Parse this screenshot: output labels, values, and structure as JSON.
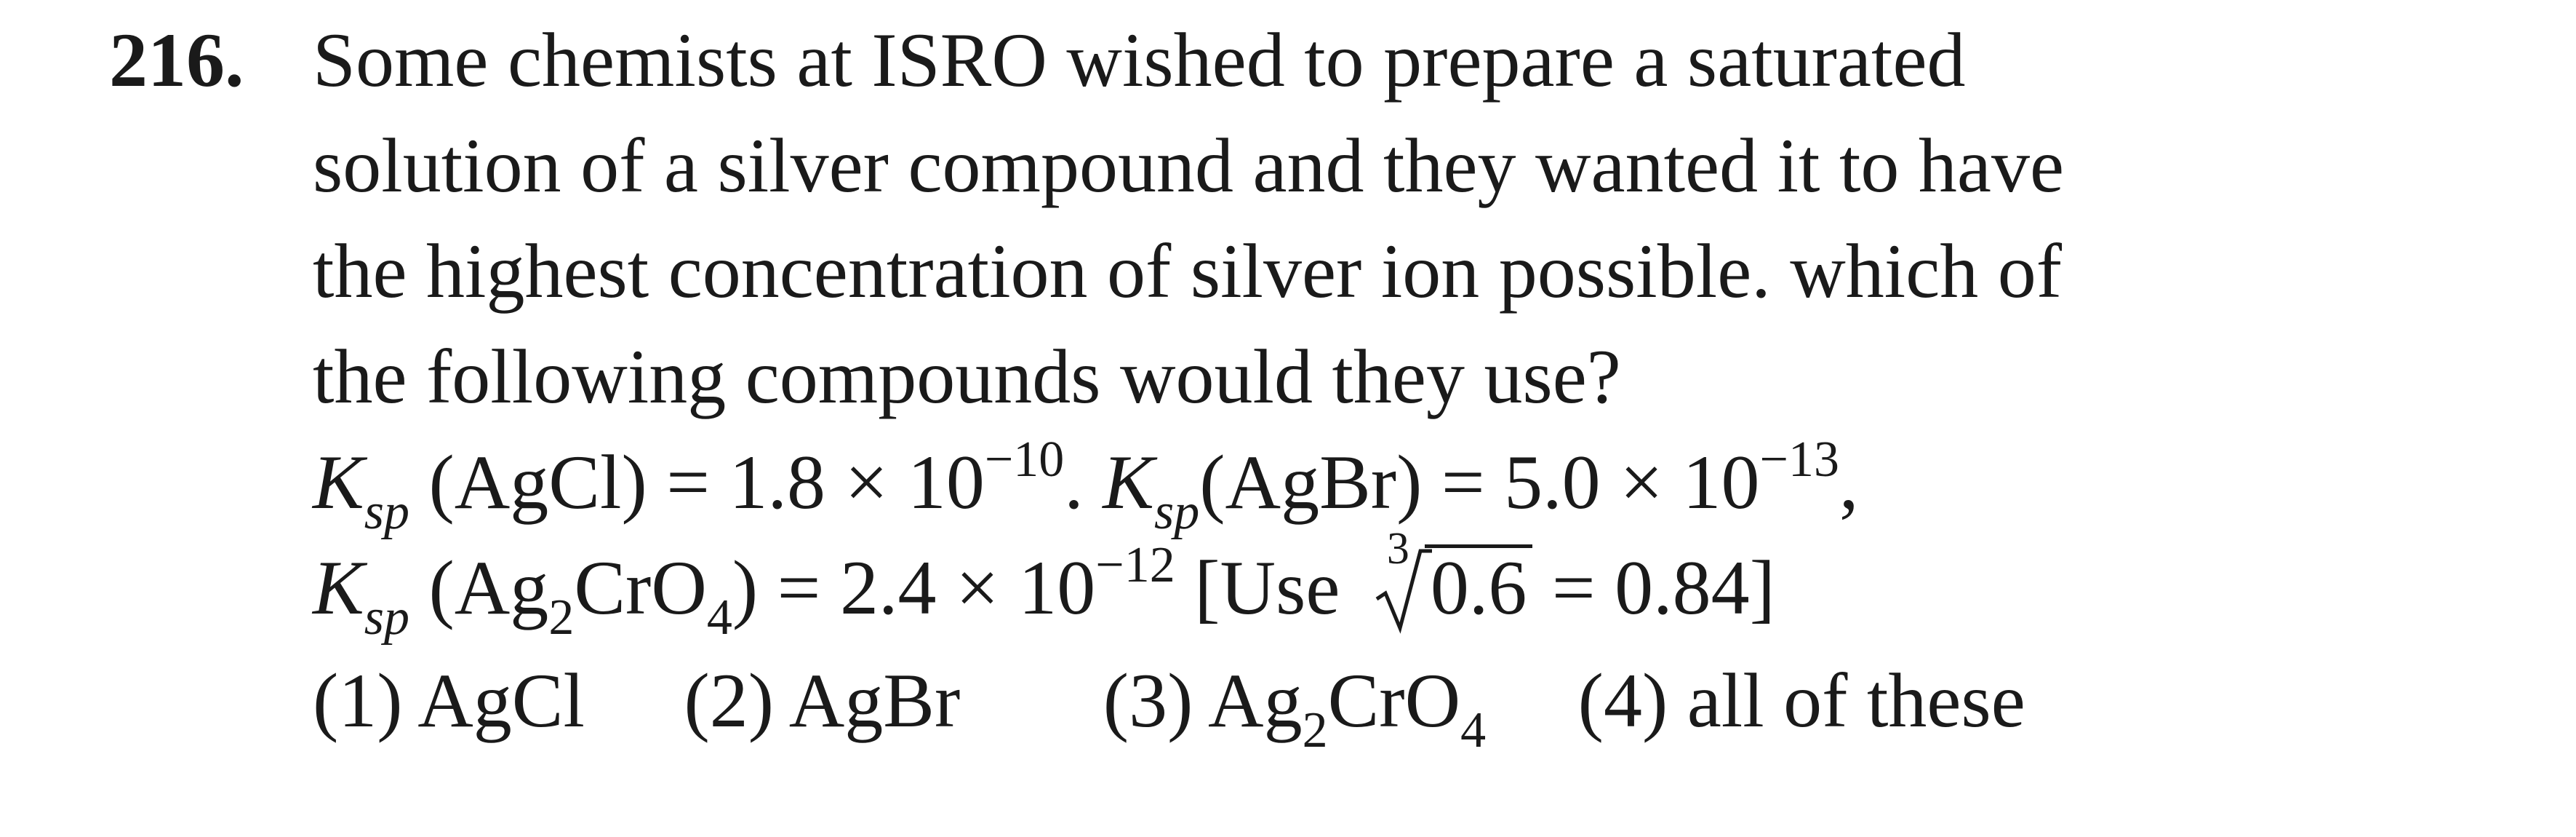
{
  "question": {
    "number": "216.",
    "lines": [
      "Some chemists at ISRO wished to prepare a saturated",
      "solution of a silver compound and they wanted it to have",
      "the highest concentration of silver ion possible. which of",
      "the following compounds would they use?"
    ]
  },
  "data_lines": {
    "ksp_symbol": "K",
    "ksp_sub": "sp",
    "agcl_label": "(AgCl) = 1.8 × 10",
    "agcl_exp": "−10",
    "sep": ". ",
    "agbr_label": "(AgBr) = 5.0 × 10",
    "agbr_exp": "−13",
    "comma": ",",
    "ag2cro4_open": "(Ag",
    "ag2cro4_sub2": "2",
    "ag2cro4_mid": "CrO",
    "ag2cro4_sub4": "4",
    "ag2cro4_val": ") = 2.4 × 10",
    "ag2cro4_exp": "−12",
    "use_open": " [Use ",
    "root_index": "3",
    "root_value": "0.6",
    "root_result": " = 0.84]"
  },
  "options": {
    "opt1": "(1) AgCl",
    "opt2": "(2) AgBr",
    "opt3_prefix": "(3) Ag",
    "opt3_sub2": "2",
    "opt3_mid": "CrO",
    "opt3_sub4": "4",
    "opt4": "(4) all of these"
  }
}
